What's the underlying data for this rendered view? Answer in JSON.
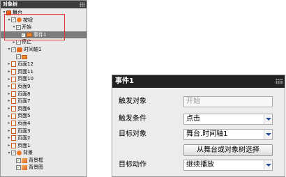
{
  "tree_panel": {
    "title": "对象树",
    "items": [
      {
        "label": "舞台",
        "indent": 0,
        "expander": "▾",
        "check": false,
        "icon": "stage-icon"
      },
      {
        "label": "按钮",
        "indent": 1,
        "expander": "▾",
        "check": true,
        "icon": "layer-icon"
      },
      {
        "label": "开始",
        "indent": 2,
        "expander": "▾",
        "check": true,
        "icon": "none"
      },
      {
        "label": "事件1",
        "indent": 3,
        "expander": "",
        "check": true,
        "icon": "event-icon",
        "selected": true
      },
      {
        "label": "停止",
        "indent": 2,
        "expander": "▸",
        "check": true,
        "icon": "none"
      },
      {
        "label": "时间轴1",
        "indent": 1,
        "expander": "▾",
        "check": true,
        "icon": "timeline-icon"
      },
      {
        "label": "",
        "indent": 2,
        "expander": "",
        "check": true,
        "icon": "event-icon"
      },
      {
        "label": "页面12",
        "indent": 1,
        "expander": "▸",
        "check": false,
        "icon": "page-icon"
      },
      {
        "label": "页面11",
        "indent": 1,
        "expander": "▸",
        "check": false,
        "icon": "page-icon"
      },
      {
        "label": "页面10",
        "indent": 1,
        "expander": "▸",
        "check": false,
        "icon": "page-icon"
      },
      {
        "label": "页面9",
        "indent": 1,
        "expander": "▸",
        "check": false,
        "icon": "page-icon"
      },
      {
        "label": "页面8",
        "indent": 1,
        "expander": "▸",
        "check": false,
        "icon": "page-icon"
      },
      {
        "label": "页面7",
        "indent": 1,
        "expander": "▸",
        "check": false,
        "icon": "page-icon"
      },
      {
        "label": "页面6",
        "indent": 1,
        "expander": "▸",
        "check": false,
        "icon": "page-icon"
      },
      {
        "label": "页面5",
        "indent": 1,
        "expander": "▸",
        "check": false,
        "icon": "page-icon"
      },
      {
        "label": "页面4",
        "indent": 1,
        "expander": "▸",
        "check": false,
        "icon": "page-icon"
      },
      {
        "label": "页面3",
        "indent": 1,
        "expander": "▸",
        "check": false,
        "icon": "page-icon"
      },
      {
        "label": "页面2",
        "indent": 1,
        "expander": "▸",
        "check": false,
        "icon": "page-icon"
      },
      {
        "label": "页面1",
        "indent": 1,
        "expander": "▸",
        "check": false,
        "icon": "page-icon"
      },
      {
        "label": "背景",
        "indent": 1,
        "expander": "▾",
        "check": true,
        "icon": "layer-icon"
      },
      {
        "label": "背景框",
        "indent": 2,
        "expander": "",
        "check": true,
        "icon": "image-icon"
      },
      {
        "label": "背景图",
        "indent": 2,
        "expander": "",
        "check": true,
        "icon": "image-icon"
      }
    ]
  },
  "event_panel": {
    "title": "事件1",
    "trigger_object_label": "触发对象",
    "trigger_object_value": "开始",
    "trigger_condition_label": "触发条件",
    "trigger_condition_value": "点击",
    "target_object_label": "目标对象",
    "target_object_value": "舞台.时间轴1",
    "select_button_label": "从舞台或对象树选择",
    "target_action_label": "目标动作",
    "target_action_value": "继续播放"
  },
  "colors": {
    "highlight": "#e33333",
    "selected_row": "#7c7c7c",
    "header_dark": "#222222"
  }
}
